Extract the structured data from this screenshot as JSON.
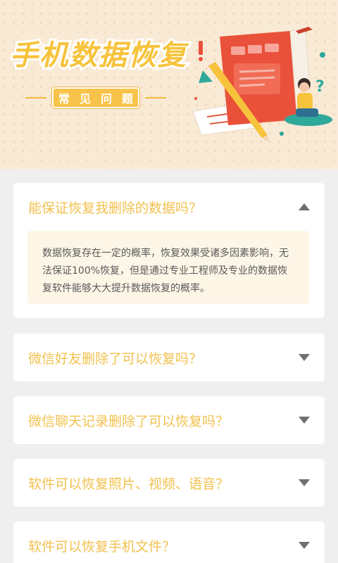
{
  "banner": {
    "title": "手机数据恢复",
    "subtitle": "常见问题"
  },
  "faq": [
    {
      "question": "能保证恢复我删除的数据吗？",
      "answer": "数据恢复存在一定的概率，恢复效果受诸多因素影响，无法保证100%恢复，但是通过专业工程师及专业的数据恢复软件能够大大提升数据恢复的概率。",
      "expanded": true
    },
    {
      "question": "微信好友删除了可以恢复吗？",
      "expanded": false
    },
    {
      "question": "微信聊天记录删除了可以恢复吗？",
      "expanded": false
    },
    {
      "question": "软件可以恢复照片、视频、语音？",
      "expanded": false
    },
    {
      "question": "软件可以恢复手机文件？",
      "expanded": false
    }
  ],
  "colors": {
    "question_text": "#f2c14e",
    "answer_bg": "#fdf6e7",
    "chevron": "#707070",
    "page_bg": "#efefef"
  },
  "icons": {
    "collapse": "chevron-up-icon",
    "expand": "chevron-down-icon"
  }
}
